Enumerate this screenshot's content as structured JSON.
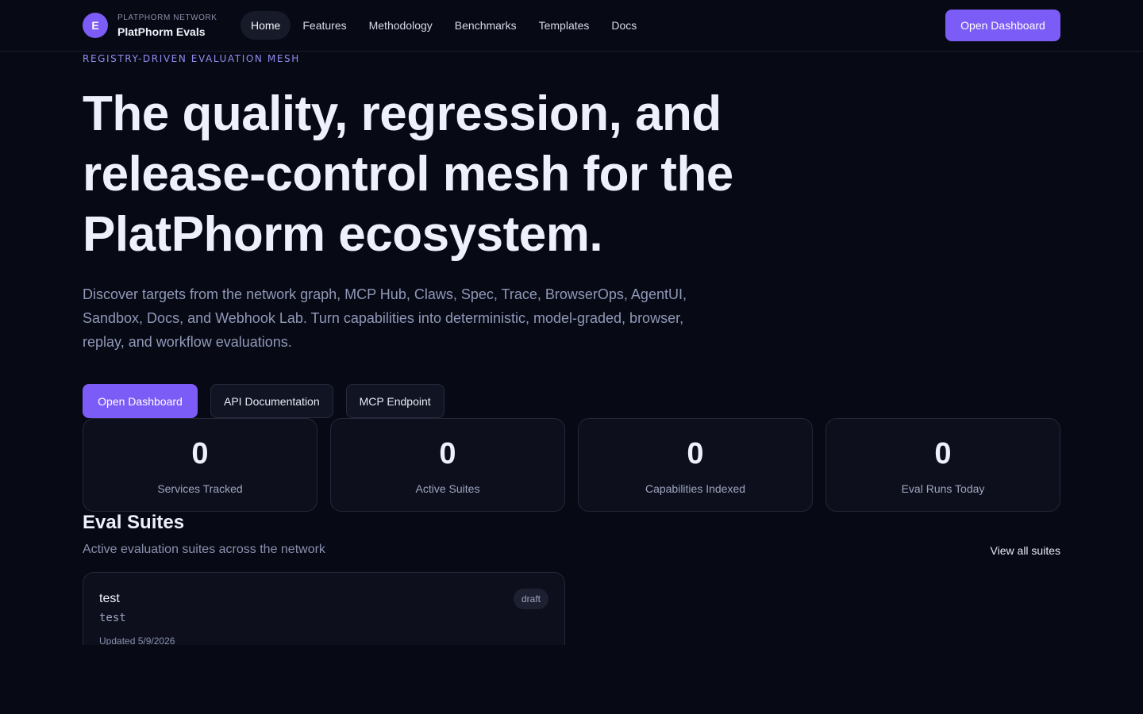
{
  "brand": {
    "logo_letter": "E",
    "subtitle": "PLATPHORM NETWORK",
    "name": "PlatPhorm Evals"
  },
  "nav": {
    "items": [
      {
        "label": "Home",
        "active": true
      },
      {
        "label": "Features"
      },
      {
        "label": "Methodology"
      },
      {
        "label": "Benchmarks"
      },
      {
        "label": "Templates"
      },
      {
        "label": "Docs"
      }
    ],
    "cta": "Open Dashboard"
  },
  "hero": {
    "eyebrow": "REGISTRY-DRIVEN EVALUATION MESH",
    "title": "The quality, regression, and release-control mesh for the PlatPhorm ecosystem.",
    "description": "Discover targets from the network graph, MCP Hub, Claws, Spec, Trace, BrowserOps, AgentUI, Sandbox, Docs, and Webhook Lab. Turn capabilities into deterministic, model-graded, browser, replay, and workflow evaluations.",
    "buttons": {
      "primary": "Open Dashboard",
      "api": "API Documentation",
      "mcp": "MCP Endpoint"
    }
  },
  "stats": [
    {
      "value": "0",
      "label": "Services Tracked"
    },
    {
      "value": "0",
      "label": "Active Suites"
    },
    {
      "value": "0",
      "label": "Capabilities Indexed"
    },
    {
      "value": "0",
      "label": "Eval Runs Today"
    }
  ],
  "suites": {
    "title": "Eval Suites",
    "subtitle": "Active evaluation suites across the network",
    "view_all": "View all suites",
    "items": [
      {
        "name": "test",
        "id": "test",
        "status": "draft",
        "updated": "Updated 5/9/2026"
      }
    ]
  },
  "colors": {
    "accent": "#7c5cf6",
    "background": "#070914",
    "card": "#0d101c"
  }
}
